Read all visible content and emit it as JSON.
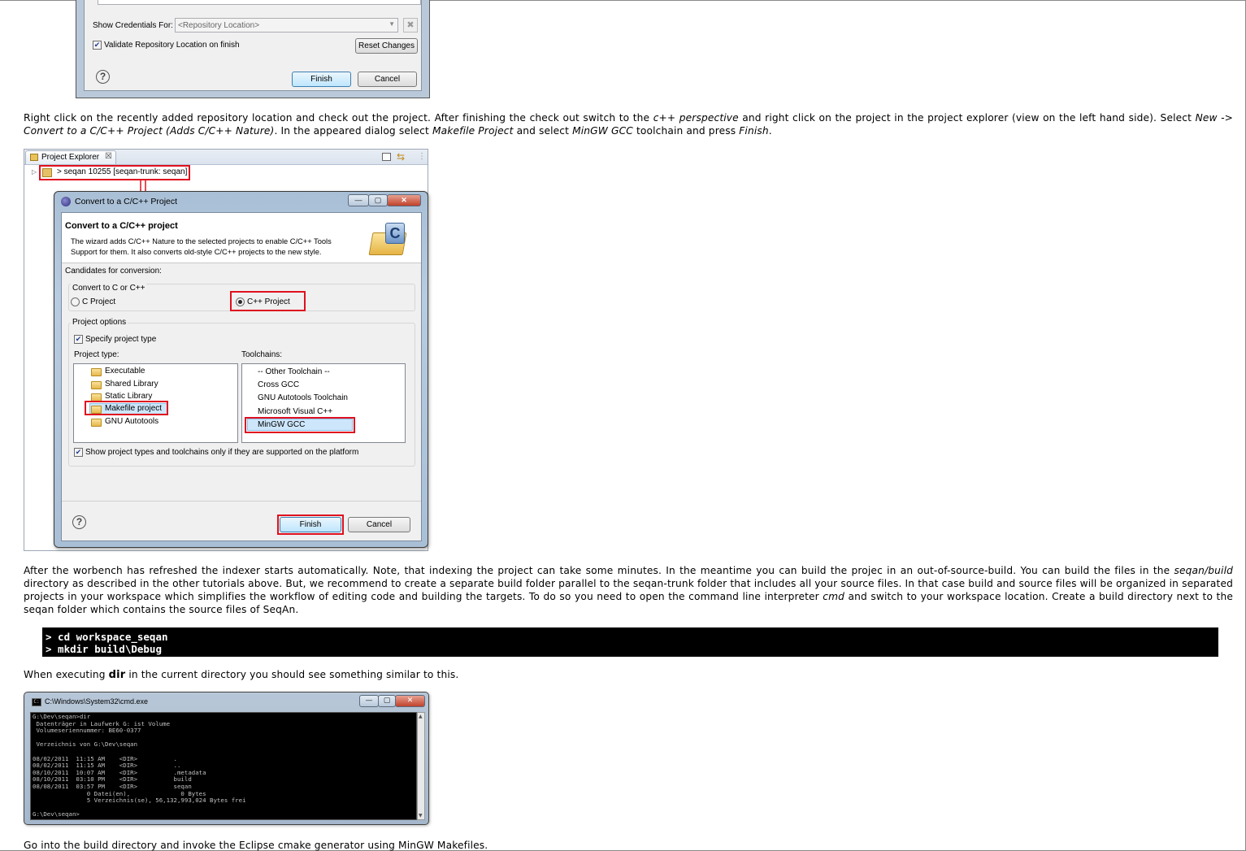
{
  "dialog_top": {
    "show_credentials_label": "Show Credentials For:",
    "repository_select_value": "<Repository Location>",
    "validate_label": "Validate Repository Location on finish",
    "reset_changes_button": "Reset Changes",
    "finish_button": "Finish",
    "cancel_button": "Cancel",
    "help_glyph": "?"
  },
  "paragraph1": {
    "t1": "Right click on the recently added repository location and check out the project. After finishing the check out switch to the ",
    "i1": "c++ perspective",
    "t2": " and right click on the project in the project explorer (view on the left hand side). Select ",
    "i2": "New -> Convert to a C/C++ Project (Adds C/C++ Nature)",
    "t3": ". In the appeared dialog select ",
    "i3": "Makefile Project",
    "t4": " and select ",
    "i4": "MinGW GCC",
    "t5": " toolchain and press ",
    "i5": "Finish",
    "t6": "."
  },
  "project_explorer": {
    "tab_label": "Project Explorer",
    "tab_close": "☒",
    "project_node": "> seqan 10255 [seqan-trunk: seqan]"
  },
  "convert_dialog": {
    "window_title": "Convert to a C/C++ Project",
    "heading": "Convert to a C/C++ project",
    "description_line1": "The wizard adds C/C++ Nature to the selected projects to enable C/C++ Tools",
    "description_line2": "Support for them. It also converts old-style C/C++ projects to the new style.",
    "candidates_label": "Candidates for conversion:",
    "convert_group_label": "Convert to C or C++",
    "c_project_label": "C Project",
    "cpp_project_label": "C++ Project",
    "project_options_label": "Project options",
    "specify_type_label": "Specify project type",
    "project_type_label": "Project type:",
    "toolchains_label": "Toolchains:",
    "project_types": [
      "Executable",
      "Shared Library",
      "Static Library",
      "Makefile project",
      "GNU Autotools"
    ],
    "toolchains": [
      "-- Other Toolchain --",
      "Cross GCC",
      "GNU Autotools Toolchain",
      "Microsoft Visual C++",
      "MinGW GCC"
    ],
    "show_supported_label": "Show project types and toolchains only if they are supported on the platform",
    "finish_button": "Finish",
    "cancel_button": "Cancel",
    "help_glyph": "?",
    "logo_letter": "C",
    "win_min": "—",
    "win_max": "▢",
    "win_close": "✕"
  },
  "paragraph2": {
    "t1": "After the worbench has refreshed the indexer starts automatically. Note, that indexing the project can take some minutes. In the meantime you can build the projec in an out-of-source-build. You can build the files in the ",
    "i1": "seqan/build",
    "t2": " directory as described in the other tutorials above. But, we recommend to create a separate build folder parallel to the seqan-trunk folder that includes all your source files. In that case build and source files will be organized in separated projects in your workspace which simplifies the workflow of editing code and building the targets. To do so you need to open the command line interpreter ",
    "i2": "cmd",
    "t3": " and switch to your workspace location. Create a build directory next to the seqan folder which contains the source files of SeqAn."
  },
  "code_block": {
    "line1": "> cd workspace_seqan",
    "line2": "> mkdir build\\Debug"
  },
  "paragraph3": {
    "t1": "When executing ",
    "b1": "dir",
    "t2": " in the current directory you should see something similar to this."
  },
  "cmd_window": {
    "title": "C:\\Windows\\System32\\cmd.exe",
    "output": "G:\\Dev\\seqan>dir\n Datenträger in Laufwerk G: ist Volume\n Volumeseriennummer: BE60-0377\n\n Verzeichnis von G:\\Dev\\seqan\n\n08/02/2011  11:15 AM    <DIR>          .\n08/02/2011  11:15 AM    <DIR>          ..\n08/10/2011  10:07 AM    <DIR>          .metadata\n08/10/2011  03:10 PM    <DIR>          build\n08/08/2011  03:57 PM    <DIR>          seqan\n               0 Datei(en),              0 Bytes\n               5 Verzeichnis(se), 56,132,993,024 Bytes frei\n\nG:\\Dev\\seqan>",
    "win_min": "—",
    "win_max": "▢",
    "win_close": "✕"
  },
  "paragraph4": {
    "text": "Go into the build directory and invoke the Eclipse cmake generator using MinGW Makefiles."
  }
}
